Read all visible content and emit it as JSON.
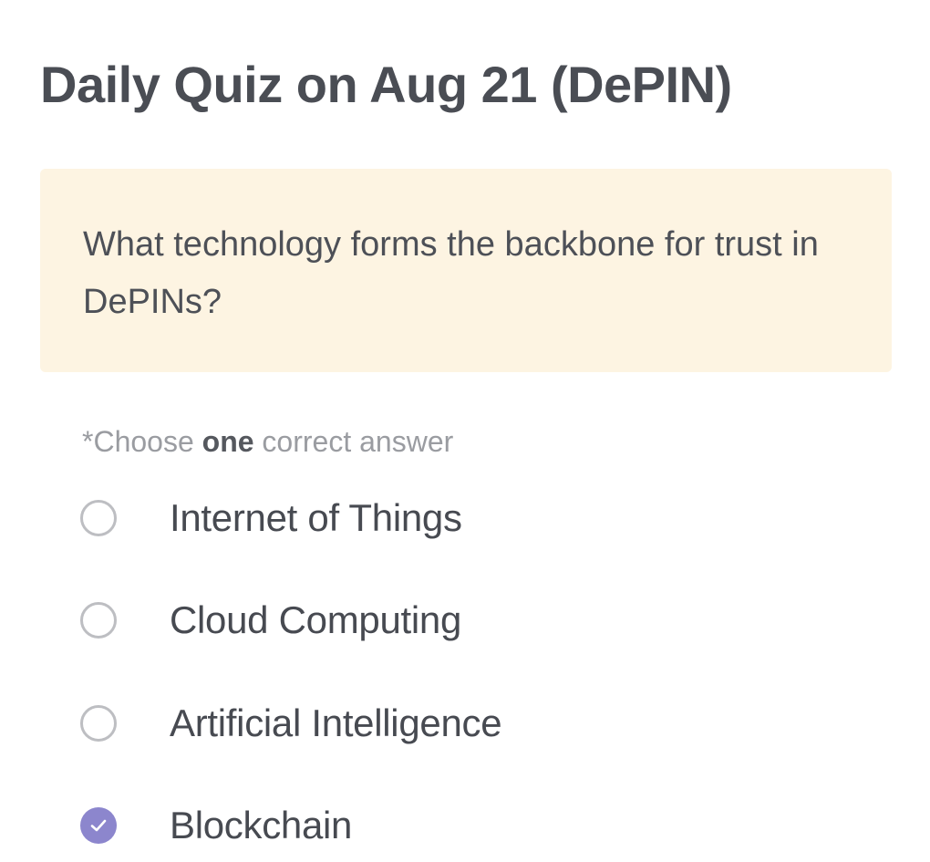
{
  "quiz": {
    "title": "Daily Quiz on Aug 21 (DePIN)",
    "question": "What technology forms the backbone for trust in DePINs?",
    "instruction": {
      "prefix": "*Choose ",
      "emphasis": "one",
      "suffix": " correct answer"
    },
    "options": [
      {
        "label": "Internet of Things",
        "selected": false
      },
      {
        "label": "Cloud Computing",
        "selected": false
      },
      {
        "label": "Artificial Intelligence",
        "selected": false
      },
      {
        "label": "Blockchain",
        "selected": true
      }
    ],
    "colors": {
      "question_background": "#fdf4e2",
      "selected_accent": "#8c86cd",
      "radio_border": "#bdbec2"
    },
    "icons": {
      "unselected": "radio-empty-icon",
      "selected": "check-circle-icon"
    }
  }
}
